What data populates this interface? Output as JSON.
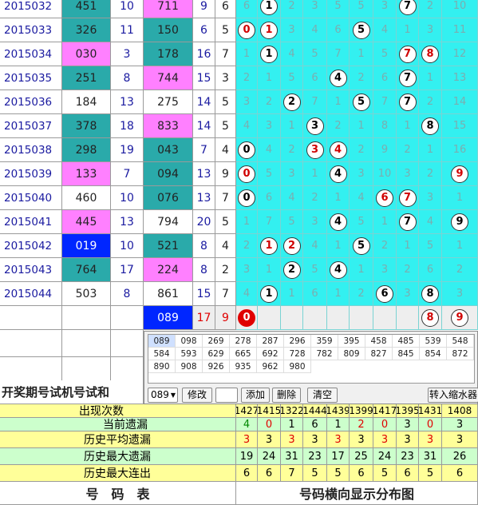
{
  "colors": {
    "teal": "#2aaaaa",
    "pink": "#ff80ff",
    "cyan": "#33f0f0",
    "blue": "#0026ff",
    "red": "#e00000",
    "yellow": "#ffff99",
    "mint": "#ccffcc",
    "white": "#ffffff"
  },
  "rows": [
    {
      "period": "2015032",
      "trial": "451",
      "trial_bg": "teal",
      "n1": "10",
      "win": "711",
      "win_bg": "pink",
      "a": "9",
      "b": "6",
      "dist": [
        [
          "6",
          0
        ],
        [
          "1",
          1
        ],
        [
          "2",
          0
        ],
        [
          "3",
          0
        ],
        [
          "5",
          0
        ],
        [
          "5",
          0
        ],
        [
          "3",
          0
        ],
        [
          "7",
          1
        ],
        [
          "2",
          0
        ],
        [
          "10",
          0
        ]
      ]
    },
    {
      "period": "2015033",
      "trial": "326",
      "trial_bg": "teal",
      "n1": "11",
      "win": "150",
      "win_bg": "teal",
      "a": "6",
      "b": "5",
      "dist": [
        [
          "0",
          2
        ],
        [
          "1",
          2
        ],
        [
          "3",
          0
        ],
        [
          "4",
          0
        ],
        [
          "6",
          0
        ],
        [
          "5",
          1
        ],
        [
          "4",
          0
        ],
        [
          "1",
          0
        ],
        [
          "3",
          0
        ],
        [
          "11",
          0
        ]
      ]
    },
    {
      "period": "2015034",
      "trial": "030",
      "trial_bg": "pink",
      "n1": "3",
      "win": "178",
      "win_bg": "teal",
      "a": "16",
      "b": "7",
      "dist": [
        [
          "1",
          0
        ],
        [
          "1",
          1
        ],
        [
          "4",
          0
        ],
        [
          "5",
          0
        ],
        [
          "7",
          0
        ],
        [
          "1",
          0
        ],
        [
          "5",
          0
        ],
        [
          "7",
          2
        ],
        [
          "8",
          2
        ],
        [
          "12",
          0
        ]
      ]
    },
    {
      "period": "2015035",
      "trial": "251",
      "trial_bg": "teal",
      "n1": "8",
      "win": "744",
      "win_bg": "pink",
      "a": "15",
      "b": "3",
      "dist": [
        [
          "2",
          0
        ],
        [
          "1",
          0
        ],
        [
          "5",
          0
        ],
        [
          "6",
          0
        ],
        [
          "4",
          1
        ],
        [
          "2",
          0
        ],
        [
          "6",
          0
        ],
        [
          "7",
          1
        ],
        [
          "1",
          0
        ],
        [
          "13",
          0
        ]
      ]
    },
    {
      "period": "2015036",
      "trial": "184",
      "trial_bg": "white",
      "n1": "13",
      "win": "275",
      "win_bg": "white",
      "a": "14",
      "b": "5",
      "dist": [
        [
          "3",
          0
        ],
        [
          "2",
          0
        ],
        [
          "2",
          1
        ],
        [
          "7",
          0
        ],
        [
          "1",
          0
        ],
        [
          "5",
          1
        ],
        [
          "7",
          0
        ],
        [
          "7",
          1
        ],
        [
          "2",
          0
        ],
        [
          "14",
          0
        ]
      ]
    },
    {
      "period": "2015037",
      "trial": "378",
      "trial_bg": "teal",
      "n1": "18",
      "win": "833",
      "win_bg": "pink",
      "a": "14",
      "b": "5",
      "dist": [
        [
          "4",
          0
        ],
        [
          "3",
          0
        ],
        [
          "1",
          0
        ],
        [
          "3",
          1
        ],
        [
          "2",
          0
        ],
        [
          "1",
          0
        ],
        [
          "8",
          0
        ],
        [
          "1",
          0
        ],
        [
          "8",
          1
        ],
        [
          "15",
          0
        ]
      ]
    },
    {
      "period": "2015038",
      "trial": "298",
      "trial_bg": "teal",
      "n1": "19",
      "win": "043",
      "win_bg": "teal",
      "a": "7",
      "b": "4",
      "dist": [
        [
          "0",
          1
        ],
        [
          "4",
          0
        ],
        [
          "2",
          0
        ],
        [
          "3",
          2
        ],
        [
          "4",
          2
        ],
        [
          "2",
          0
        ],
        [
          "9",
          0
        ],
        [
          "2",
          0
        ],
        [
          "1",
          0
        ],
        [
          "16",
          0
        ]
      ]
    },
    {
      "period": "2015039",
      "trial": "133",
      "trial_bg": "pink",
      "n1": "7",
      "win": "094",
      "win_bg": "teal",
      "a": "13",
      "b": "9",
      "dist": [
        [
          "0",
          2
        ],
        [
          "5",
          0
        ],
        [
          "3",
          0
        ],
        [
          "1",
          0
        ],
        [
          "4",
          1
        ],
        [
          "3",
          0
        ],
        [
          "10",
          0
        ],
        [
          "3",
          0
        ],
        [
          "2",
          0
        ],
        [
          "9",
          2
        ]
      ]
    },
    {
      "period": "2015040",
      "trial": "460",
      "trial_bg": "white",
      "n1": "10",
      "win": "076",
      "win_bg": "teal",
      "a": "13",
      "b": "7",
      "dist": [
        [
          "0",
          1
        ],
        [
          "6",
          0
        ],
        [
          "4",
          0
        ],
        [
          "2",
          0
        ],
        [
          "1",
          0
        ],
        [
          "4",
          0
        ],
        [
          "6",
          2
        ],
        [
          "7",
          2
        ],
        [
          "3",
          0
        ],
        [
          "1",
          0
        ]
      ]
    },
    {
      "period": "2015041",
      "trial": "445",
      "trial_bg": "pink",
      "n1": "13",
      "win": "794",
      "win_bg": "white",
      "a": "20",
      "b": "5",
      "dist": [
        [
          "1",
          0
        ],
        [
          "7",
          0
        ],
        [
          "5",
          0
        ],
        [
          "3",
          0
        ],
        [
          "4",
          1
        ],
        [
          "5",
          0
        ],
        [
          "1",
          0
        ],
        [
          "7",
          1
        ],
        [
          "4",
          0
        ],
        [
          "9",
          1
        ]
      ]
    },
    {
      "period": "2015042",
      "trial": "019",
      "trial_bg": "blue",
      "n1": "10",
      "win": "521",
      "win_bg": "teal",
      "a": "8",
      "b": "4",
      "dist": [
        [
          "2",
          0
        ],
        [
          "1",
          2
        ],
        [
          "2",
          2
        ],
        [
          "4",
          0
        ],
        [
          "1",
          0
        ],
        [
          "5",
          1
        ],
        [
          "2",
          0
        ],
        [
          "1",
          0
        ],
        [
          "5",
          0
        ],
        [
          "1",
          0
        ]
      ]
    },
    {
      "period": "2015043",
      "trial": "764",
      "trial_bg": "teal",
      "n1": "17",
      "win": "224",
      "win_bg": "pink",
      "a": "8",
      "b": "2",
      "dist": [
        [
          "3",
          0
        ],
        [
          "1",
          0
        ],
        [
          "2",
          1
        ],
        [
          "5",
          0
        ],
        [
          "4",
          1
        ],
        [
          "1",
          0
        ],
        [
          "3",
          0
        ],
        [
          "2",
          0
        ],
        [
          "6",
          0
        ],
        [
          "2",
          0
        ]
      ]
    },
    {
      "period": "2015044",
      "trial": "503",
      "trial_bg": "white",
      "n1": "8",
      "win": "861",
      "win_bg": "white",
      "a": "15",
      "b": "7",
      "dist": [
        [
          "4",
          0
        ],
        [
          "1",
          1
        ],
        [
          "1",
          0
        ],
        [
          "6",
          0
        ],
        [
          "1",
          0
        ],
        [
          "2",
          0
        ],
        [
          "6",
          1
        ],
        [
          "3",
          0
        ],
        [
          "8",
          1
        ],
        [
          "3",
          0
        ]
      ]
    }
  ],
  "current": {
    "win": "089",
    "a": "17",
    "b": "9",
    "balls": [
      [
        "0",
        3
      ],
      [
        "8",
        2
      ],
      [
        "9",
        2
      ]
    ]
  },
  "popup": {
    "numbers": [
      "089",
      "098",
      "269",
      "278",
      "287",
      "296",
      "359",
      "395",
      "458",
      "485",
      "539",
      "548",
      "584",
      "593",
      "629",
      "665",
      "692",
      "728",
      "782",
      "809",
      "827",
      "845",
      "854",
      "872",
      "890",
      "908",
      "926",
      "935",
      "962",
      "980"
    ],
    "select_value": "089",
    "btn_edit": "修改",
    "btn_add": "添加",
    "btn_delete": "删除",
    "btn_clear": "清空",
    "btn_shrink": "转入缩水器"
  },
  "header_label": "开奖期号试机号试和",
  "stats": {
    "labels": [
      "出现次数",
      "当前遗漏",
      "历史平均遗漏",
      "历史最大遗漏",
      "历史最大连出"
    ],
    "appear": [
      "1427",
      "1415",
      "1322",
      "1444",
      "1439",
      "1399",
      "1417",
      "1395",
      "1431",
      "1408"
    ],
    "current_miss": [
      "4",
      "0",
      "1",
      "6",
      "1",
      "2",
      "0",
      "3",
      "0",
      "3"
    ],
    "avg_miss": [
      "3",
      "3",
      "3",
      "3",
      "3",
      "3",
      "3",
      "3",
      "3",
      "3"
    ],
    "max_miss": [
      "19",
      "24",
      "31",
      "23",
      "17",
      "25",
      "24",
      "23",
      "31",
      "26"
    ],
    "max_streak": [
      "6",
      "6",
      "7",
      "5",
      "5",
      "6",
      "5",
      "6",
      "5",
      "6"
    ]
  },
  "footer": {
    "left": "号　码　表",
    "right": "号码横向显示分布图"
  }
}
